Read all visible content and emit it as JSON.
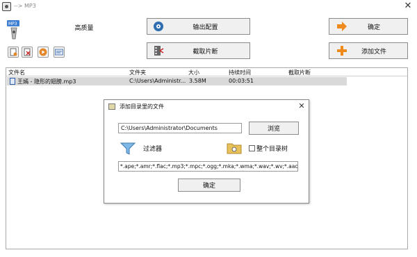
{
  "window": {
    "title": "--> MP3"
  },
  "toolbar": {
    "profile_label": "高质量",
    "output_settings_label": "输出配置",
    "clip_label": "截取片断",
    "ok_label": "确定",
    "add_file_label": "添加文件"
  },
  "file_list": {
    "columns": [
      "文件名",
      "文件夹",
      "大小",
      "持续时间",
      "截取片断"
    ],
    "rows": [
      {
        "name": "王嫣 - 隐形的翅膀.mp3",
        "folder": "C:\\Users\\Administr...",
        "size": "3.58M",
        "duration": "00:03:51",
        "clip": ""
      }
    ]
  },
  "dialog": {
    "title": "添加目录里的文件",
    "directory_value": "C:\\Users\\Administrator\\Documents",
    "browse_label": "浏览",
    "filter_label": "过滤器",
    "subdir_label": "整个目录树",
    "subdir_checked": false,
    "extensions_value": "*.ape;*.amr;*.flac;*.mp3;*.mpc;*.ogg;*.mka;*.wma;*.wav;*.wv;*.aac",
    "ok_label": "确定"
  },
  "colors": {
    "selected_row": "#d9d9d9",
    "button_bg": "#f0f0f0",
    "accent_orange": "#f08a1c"
  },
  "icons": {
    "title": "app-icon",
    "profile": "mp3-profile-icon",
    "output": "settings-disc-icon",
    "clip": "film-clip-icon",
    "ok": "arrow-right-icon",
    "add": "plus-icon",
    "filter": "filter-icon",
    "folder": "folder-icon"
  }
}
